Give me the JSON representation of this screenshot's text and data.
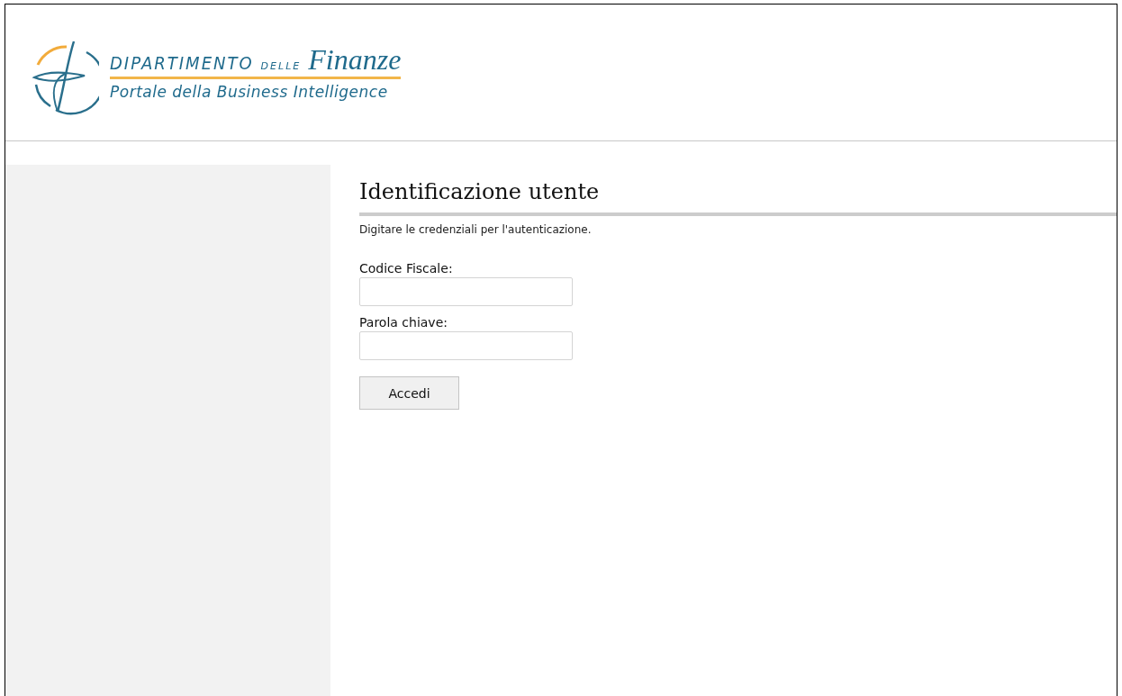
{
  "header": {
    "logo": {
      "word_1": "DIPARTIMENTO",
      "word_2": "DELLE",
      "word_3": "Finanze",
      "subtitle": "Portale della Business Intelligence"
    }
  },
  "login": {
    "title": "Identificazione utente",
    "instructions": "Digitare le credenziali per l'autenticazione.",
    "fields": [
      {
        "label": "Codice Fiscale:"
      },
      {
        "label": "Parola chiave:"
      }
    ],
    "button": "Accedi"
  }
}
